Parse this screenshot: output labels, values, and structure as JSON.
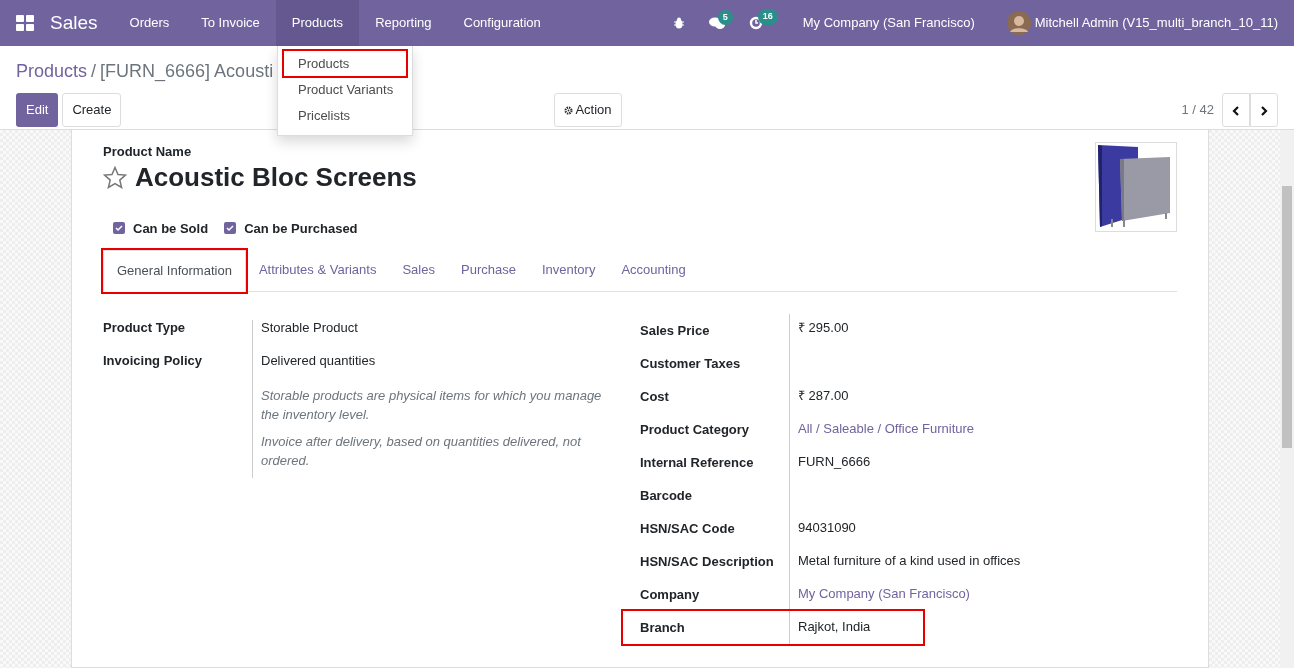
{
  "navbar": {
    "app": "Sales",
    "menus": [
      {
        "label": "Orders",
        "selected": false
      },
      {
        "label": "To Invoice",
        "selected": false
      },
      {
        "label": "Products",
        "selected": true
      },
      {
        "label": "Reporting",
        "selected": false
      },
      {
        "label": "Configuration",
        "selected": false
      }
    ],
    "dropdown": [
      {
        "label": "Products",
        "highlighted": true
      },
      {
        "label": "Product Variants",
        "highlighted": false
      },
      {
        "label": "Pricelists",
        "highlighted": false
      }
    ],
    "messages_count": "5",
    "activities_count": "16",
    "company": "My Company (San Francisco)",
    "user": "Mitchell Admin (V15_multi_branch_10_11)"
  },
  "breadcrumb": {
    "parent": "Products",
    "separator": "/",
    "current": "[FURN_6666] Acousti"
  },
  "buttons": {
    "edit": "Edit",
    "create": "Create",
    "action": "Action"
  },
  "pager": "1 / 42",
  "form": {
    "name_label": "Product Name",
    "name": "Acoustic Bloc Screens",
    "favorite": false,
    "checkboxes": [
      {
        "label": "Can be Sold",
        "checked": true
      },
      {
        "label": "Can be Purchased",
        "checked": true
      }
    ],
    "tabs": [
      {
        "label": "General Information",
        "selected": true,
        "highlighted": true
      },
      {
        "label": "Attributes & Variants",
        "selected": false,
        "highlighted": false
      },
      {
        "label": "Sales",
        "selected": false,
        "highlighted": false
      },
      {
        "label": "Purchase",
        "selected": false,
        "highlighted": false
      },
      {
        "label": "Inventory",
        "selected": false,
        "highlighted": false
      },
      {
        "label": "Accounting",
        "selected": false,
        "highlighted": false
      }
    ],
    "left_fields": [
      {
        "label": "Product Type",
        "value": "Storable Product"
      },
      {
        "label": "Invoicing Policy",
        "value": "Delivered quantities"
      }
    ],
    "help": [
      "Storable products are physical items for which you manage the inventory level.",
      "Invoice after delivery, based on quantities delivered, not ordered."
    ],
    "right_fields": [
      {
        "label": "Sales Price",
        "value": "₹ 295.00",
        "kind": "text",
        "highlighted": false
      },
      {
        "label": "Customer Taxes",
        "kind": "text",
        "highlighted": false
      },
      {
        "label": "Cost",
        "value": "₹ 287.00",
        "kind": "text",
        "highlighted": false
      },
      {
        "label": "Product Category",
        "value": "All / Saleable / Office Furniture",
        "kind": "link",
        "highlighted": false
      },
      {
        "label": "Internal Reference",
        "value": "FURN_6666",
        "kind": "text",
        "highlighted": false
      },
      {
        "label": "Barcode",
        "kind": "text",
        "highlighted": false
      },
      {
        "label": "HSN/SAC Code",
        "value": "94031090",
        "kind": "text",
        "highlighted": false
      },
      {
        "label": "HSN/SAC Description",
        "value": "Metal furniture of a kind used in offices",
        "kind": "text",
        "highlighted": false
      },
      {
        "label": "Company",
        "value": "My Company (San Francisco)",
        "kind": "link",
        "highlighted": false
      },
      {
        "label": "Branch",
        "value": "Rajkot, India",
        "kind": "text",
        "highlighted": true
      }
    ]
  }
}
